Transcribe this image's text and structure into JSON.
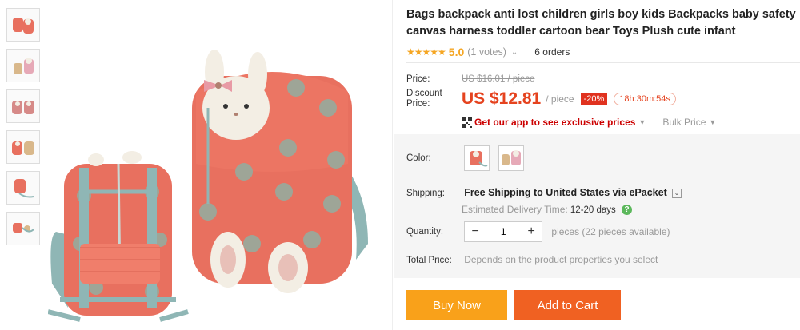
{
  "product": {
    "title": "Bags backpack anti lost children girls boy kids Backpacks baby safety canvas harness toddler cartoon bear Toys Plush cute infant",
    "stars": "★★★★★",
    "rating": "5.0",
    "votes": "(1 votes)",
    "orders": "6 orders"
  },
  "price": {
    "price_label": "Price:",
    "old_price": "US $16.01 / piece",
    "discount_label": "Discount Price:",
    "new_price": "US $12.81",
    "unit": "/ piece",
    "discount_pct": "-20%",
    "timer": "18h:30m:54s",
    "app_link": "Get our app to see exclusive prices",
    "bulk": "Bulk Price"
  },
  "options": {
    "color_label": "Color:",
    "shipping_label": "Shipping:",
    "shipping_text": "Free Shipping to United States via ePacket",
    "delivery_label": "Estimated Delivery Time:",
    "delivery_value": "12-20 days",
    "quantity_label": "Quantity:",
    "quantity_value": "1",
    "available": "pieces (22 pieces available)",
    "total_label": "Total Price:",
    "total_note": "Depends on the product properties you select"
  },
  "buttons": {
    "buy_now": "Buy Now",
    "add_to_cart": "Add to Cart"
  },
  "colors": {
    "backpack": "#e8705f",
    "dots": "#9ea597",
    "strap": "#8fb6b5",
    "price_red": "#e5431f",
    "buy_orange": "#f9a11a",
    "cart_orange": "#f06122"
  }
}
